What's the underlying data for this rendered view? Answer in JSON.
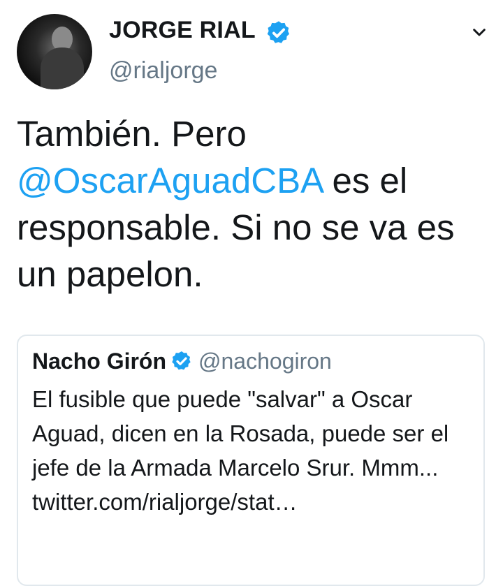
{
  "tweet": {
    "author": {
      "name": "JORGE RIAL",
      "handle": "@rialjorge",
      "verified": true,
      "avatar_icon": "avatar-photo-icon"
    },
    "text_before": "También. Pero ",
    "mention": "@OscarAguadCBA",
    "text_after": " es el responsable. Si no se va es un papelon.",
    "menu_icon": "chevron-down-icon"
  },
  "quoted_tweet": {
    "author": {
      "name": "Nacho Girón",
      "handle": "@nachogiron",
      "verified": true
    },
    "text": "El fusible que puede \"salvar\" a Oscar Aguad, dicen en la Rosada, puede ser el jefe de la Armada Marcelo Srur. Mmm... twitter.com/rialjorge/stat…"
  },
  "colors": {
    "link": "#1da1f2",
    "verified": "#1da1f2",
    "text": "#14171a",
    "secondary": "#657786",
    "border": "#e1e8ed"
  }
}
